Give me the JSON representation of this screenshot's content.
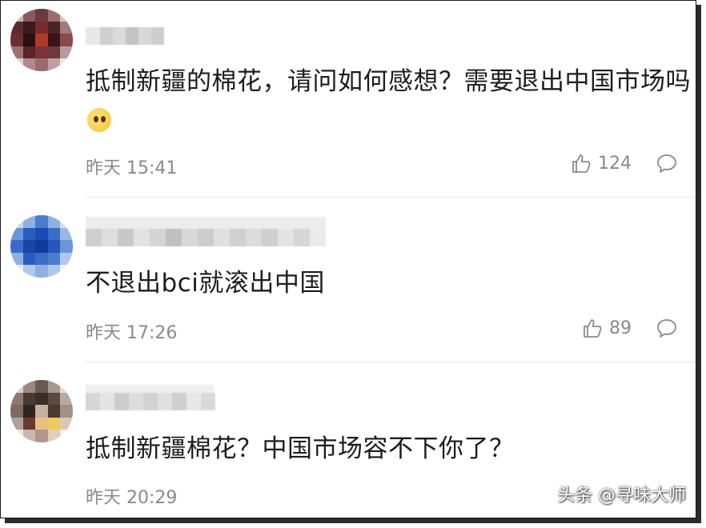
{
  "comments": [
    {
      "text": "抵制新疆的棉花，请问如何感想？需要退出中国市场吗",
      "emoji": "thinking-face-icon",
      "time": "昨天 15:41",
      "likes": "124"
    },
    {
      "text": "不退出bci就滚出中国",
      "time": "昨天 17:26",
      "likes": "89"
    },
    {
      "text": "抵制新疆棉花？中国市场容不下你了？",
      "time": "昨天 20:29"
    }
  ],
  "watermark": "头条 @寻味大师",
  "colors": {
    "text": "#1c1c1c",
    "meta": "#8a8a8a",
    "divider": "#e6e6e6"
  }
}
